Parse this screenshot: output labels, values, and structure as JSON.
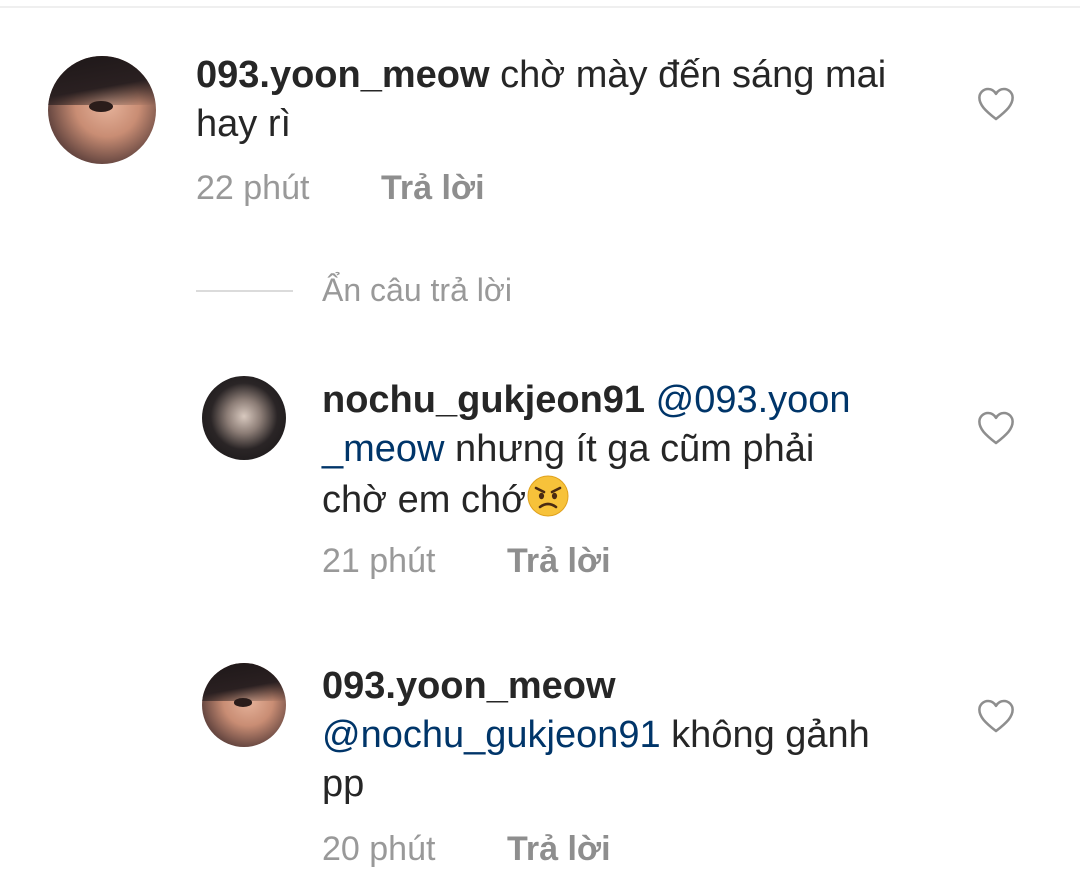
{
  "comments": [
    {
      "username": "093.yoon_meow",
      "text_line1": " chờ mày đến sáng mai",
      "text_line2": "hay rì",
      "time": "22 phút",
      "reply": "Trả lời",
      "avatar_icon": "user-avatar-photo"
    },
    {
      "username": "nochu_gukjeon91",
      "mention_part1": "@093.yoon",
      "mention_part2": "_meow",
      "text_line2": " nhưng ít ga cũm phải",
      "text_line3": "chờ em chớ",
      "emoji": "angry-face-emoji",
      "time": "21 phút",
      "reply": "Trả lời",
      "avatar_icon": "user-avatar-photo"
    },
    {
      "username": "093.yoon_meow",
      "mention": "@nochu_gukjeon91",
      "text_line2": " không gảnh",
      "text_line3": "pp",
      "time": "20 phút",
      "reply": "Trả lời",
      "avatar_icon": "user-avatar-photo"
    }
  ],
  "hide_replies": "Ẩn câu trả lời",
  "colors": {
    "mention": "#003569",
    "meta": "#999999",
    "text": "#262626"
  }
}
